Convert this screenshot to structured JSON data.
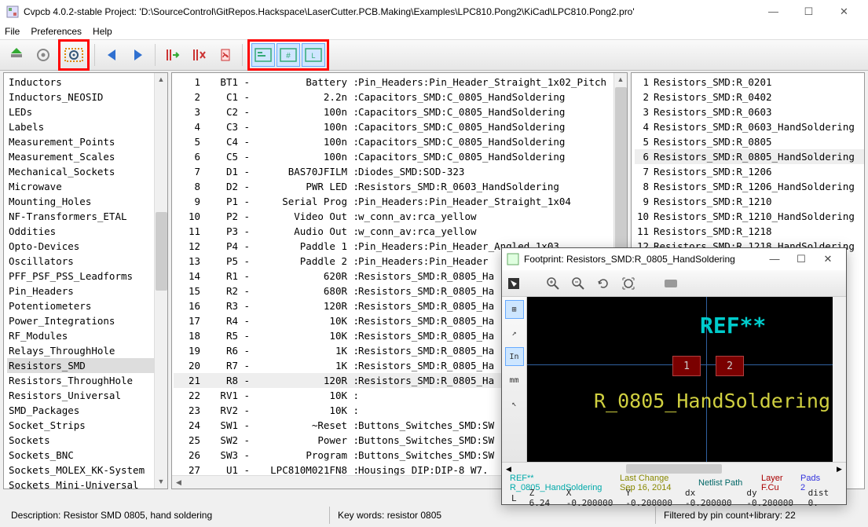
{
  "window": {
    "title": "Cvpcb 4.0.2-stable  Project: 'D:\\SourceControl\\GitRepos.Hackspace\\LaserCutter.PCB.Making\\Examples\\LPC810.Pong2\\KiCad\\LPC810.Pong2.pro'",
    "min": "—",
    "max": "☐",
    "close": "✕"
  },
  "menu": {
    "file": "File",
    "prefs": "Preferences",
    "help": "Help"
  },
  "libs": [
    "Inductors",
    "Inductors_NEOSID",
    "LEDs",
    "Labels",
    "Measurement_Points",
    "Measurement_Scales",
    "Mechanical_Sockets",
    "Microwave",
    "Mounting_Holes",
    "NF-Transformers_ETAL",
    "Oddities",
    "Opto-Devices",
    "Oscillators",
    "PFF_PSF_PSS_Leadforms",
    "Pin_Headers",
    "Potentiometers",
    "Power_Integrations",
    "RF_Modules",
    "Relays_ThroughHole",
    "Resistors_SMD",
    "Resistors_ThroughHole",
    "Resistors_Universal",
    "SMD_Packages",
    "Socket_Strips",
    "Sockets",
    "Sockets_BNC",
    "Sockets_MOLEX_KK-System",
    "Sockets_Mini-Universal"
  ],
  "libs_selected_index": 19,
  "components": [
    {
      "n": 1,
      "ref": "BT1",
      "val": "Battery",
      "fp": "Pin_Headers:Pin_Header_Straight_1x02_Pitch"
    },
    {
      "n": 2,
      "ref": "C1",
      "val": "2.2n",
      "fp": "Capacitors_SMD:C_0805_HandSoldering"
    },
    {
      "n": 3,
      "ref": "C2",
      "val": "100n",
      "fp": "Capacitors_SMD:C_0805_HandSoldering"
    },
    {
      "n": 4,
      "ref": "C3",
      "val": "100n",
      "fp": "Capacitors_SMD:C_0805_HandSoldering"
    },
    {
      "n": 5,
      "ref": "C4",
      "val": "100n",
      "fp": "Capacitors_SMD:C_0805_HandSoldering"
    },
    {
      "n": 6,
      "ref": "C5",
      "val": "100n",
      "fp": "Capacitors_SMD:C_0805_HandSoldering"
    },
    {
      "n": 7,
      "ref": "D1",
      "val": "BAS70JFILM",
      "fp": "Diodes_SMD:SOD-323"
    },
    {
      "n": 8,
      "ref": "D2",
      "val": "PWR LED",
      "fp": "Resistors_SMD:R_0603_HandSoldering"
    },
    {
      "n": 9,
      "ref": "P1",
      "val": "Serial Prog",
      "fp": "Pin_Headers:Pin_Header_Straight_1x04"
    },
    {
      "n": 10,
      "ref": "P2",
      "val": "Video Out",
      "fp": "w_conn_av:rca_yellow"
    },
    {
      "n": 11,
      "ref": "P3",
      "val": "Audio Out",
      "fp": "w_conn_av:rca_yellow"
    },
    {
      "n": 12,
      "ref": "P4",
      "val": "Paddle 1",
      "fp": "Pin_Headers:Pin_Header_Angled_1x03"
    },
    {
      "n": 13,
      "ref": "P5",
      "val": "Paddle 2",
      "fp": "Pin_Headers:Pin_Header"
    },
    {
      "n": 14,
      "ref": "R1",
      "val": "620R",
      "fp": "Resistors_SMD:R_0805_Ha"
    },
    {
      "n": 15,
      "ref": "R2",
      "val": "680R",
      "fp": "Resistors_SMD:R_0805_Ha"
    },
    {
      "n": 16,
      "ref": "R3",
      "val": "120R",
      "fp": "Resistors_SMD:R_0805_Ha"
    },
    {
      "n": 17,
      "ref": "R4",
      "val": "10K",
      "fp": "Resistors_SMD:R_0805_Ha"
    },
    {
      "n": 18,
      "ref": "R5",
      "val": "10K",
      "fp": "Resistors_SMD:R_0805_Ha"
    },
    {
      "n": 19,
      "ref": "R6",
      "val": "1K",
      "fp": "Resistors_SMD:R_0805_Ha"
    },
    {
      "n": 20,
      "ref": "R7",
      "val": "1K",
      "fp": "Resistors_SMD:R_0805_Ha"
    },
    {
      "n": 21,
      "ref": "R8",
      "val": "120R",
      "fp": "Resistors_SMD:R_0805_Ha"
    },
    {
      "n": 22,
      "ref": "RV1",
      "val": "10K",
      "fp": ""
    },
    {
      "n": 23,
      "ref": "RV2",
      "val": "10K",
      "fp": ""
    },
    {
      "n": 24,
      "ref": "SW1",
      "val": "~Reset",
      "fp": "Buttons_Switches_SMD:SW"
    },
    {
      "n": 25,
      "ref": "SW2",
      "val": "Power",
      "fp": "Buttons_Switches_SMD:SW"
    },
    {
      "n": 26,
      "ref": "SW3",
      "val": "Program",
      "fp": "Buttons_Switches_SMD:SW"
    },
    {
      "n": 27,
      "ref": "U1",
      "val": "LPC810M021FN8",
      "fp": "Housings_DIP:DIP-8_W7."
    }
  ],
  "components_selected_index": 20,
  "footprints": [
    {
      "n": 1,
      "name": "Resistors_SMD:R_0201"
    },
    {
      "n": 2,
      "name": "Resistors_SMD:R_0402"
    },
    {
      "n": 3,
      "name": "Resistors_SMD:R_0603"
    },
    {
      "n": 4,
      "name": "Resistors_SMD:R_0603_HandSoldering"
    },
    {
      "n": 5,
      "name": "Resistors_SMD:R_0805"
    },
    {
      "n": 6,
      "name": "Resistors_SMD:R_0805_HandSoldering"
    },
    {
      "n": 7,
      "name": "Resistors_SMD:R_1206"
    },
    {
      "n": 8,
      "name": "Resistors_SMD:R_1206_HandSoldering"
    },
    {
      "n": 9,
      "name": "Resistors_SMD:R_1210"
    },
    {
      "n": 10,
      "name": "Resistors_SMD:R_1210_HandSoldering"
    },
    {
      "n": 11,
      "name": "Resistors_SMD:R_1218"
    },
    {
      "n": 12,
      "name": "Resistors_SMD:R_1218_HandSoldering"
    }
  ],
  "footprints_selected_index": 5,
  "status": {
    "desc": "Description: Resistor SMD 0805, hand soldering",
    "key": "Key words: resistor 0805",
    "filter": "Filtered by pin count+library: 22"
  },
  "fpviewer": {
    "title": "Footprint: Resistors_SMD:R_0805_HandSoldering",
    "ref": "REF**",
    "name": "R_0805_HandSoldering",
    "pad1": "1",
    "pad2": "2",
    "side": {
      "grid": "⊞",
      "polar": "↗",
      "in": "In",
      "mm": "mm",
      "cursor": "↖"
    },
    "info": {
      "ref_lbl": "REF**",
      "name_lbl": "R_0805_HandSoldering",
      "lc_lbl": "Last Change",
      "lc_val": "Sep 16, 2014",
      "nl_lbl": "Netlist Path",
      "layer_lbl": "Layer",
      "layer_val": "F.Cu",
      "pads_lbl": "Pads",
      "pads_val": "2"
    },
    "coords": {
      "L": "L",
      "Z": "Z 6.24",
      "X": "X -0.200000",
      "Y": "Y -0.200000",
      "dx": "dx -0.200000",
      "dy": "dy -0.200000",
      "dist": "dist 0."
    }
  }
}
